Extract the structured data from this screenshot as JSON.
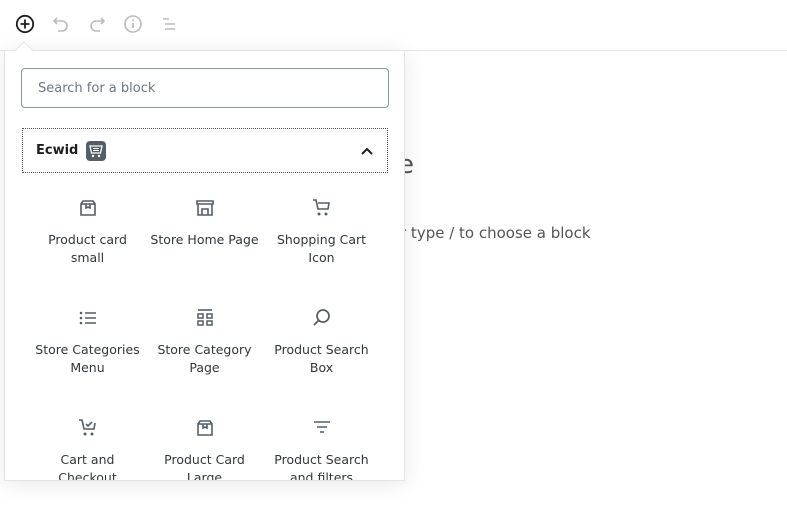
{
  "toolbar": {
    "buttons": [
      {
        "name": "add-block",
        "icon": "plus-circle-icon"
      },
      {
        "name": "undo",
        "icon": "undo-icon"
      },
      {
        "name": "redo",
        "icon": "redo-icon"
      },
      {
        "name": "info",
        "icon": "info-icon"
      },
      {
        "name": "outline",
        "icon": "list-icon"
      }
    ]
  },
  "editor": {
    "title_fragment": "e",
    "hint_fragment": "r type / to choose a block"
  },
  "inserter": {
    "search_placeholder": "Search for a block",
    "panel": {
      "title": "Ecwid",
      "icon": "ecwid-cart-icon",
      "expanded": true
    },
    "blocks": [
      {
        "label": "Product card small",
        "icon": "box-icon"
      },
      {
        "label": "Store Home Page",
        "icon": "store-icon"
      },
      {
        "label": "Shopping Cart Icon",
        "icon": "cart-icon"
      },
      {
        "label": "Store Categories Menu",
        "icon": "list-icon"
      },
      {
        "label": "Store Category Page",
        "icon": "grid-icon"
      },
      {
        "label": "Product Search Box",
        "icon": "search-icon"
      },
      {
        "label": "Cart and Checkout",
        "icon": "cart-check-icon"
      },
      {
        "label": "Product Card Large",
        "icon": "box-icon"
      },
      {
        "label": "Product Search and filters",
        "icon": "filter-icon"
      }
    ]
  }
}
